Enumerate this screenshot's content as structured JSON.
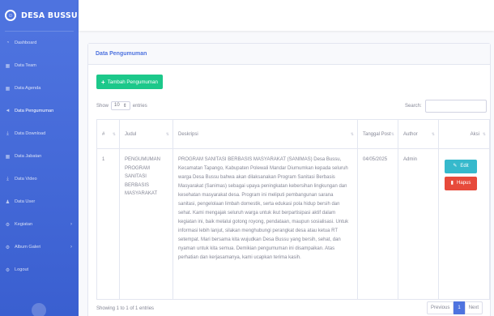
{
  "brand": {
    "name": "DESA BUSSU",
    "icon": "smile-icon"
  },
  "sidebar": {
    "items": [
      {
        "label": "Dashboard",
        "icon": "gauge-icon"
      },
      {
        "label": "Data Team",
        "icon": "table-icon"
      },
      {
        "label": "Data Agenda",
        "icon": "table-icon"
      },
      {
        "label": "Data Pengumuman",
        "icon": "bullhorn-icon"
      },
      {
        "label": "Data Download",
        "icon": "download-icon"
      },
      {
        "label": "Data Jabatan",
        "icon": "table-icon"
      },
      {
        "label": "Data Video",
        "icon": "download-icon"
      },
      {
        "label": "Data User",
        "icon": "users-icon"
      },
      {
        "label": "Kegiatan",
        "icon": "gear-icon",
        "arrow": "›"
      },
      {
        "label": "Album Galeri",
        "icon": "gear-icon",
        "arrow": "›"
      },
      {
        "label": "Logout",
        "icon": "gear-icon"
      }
    ]
  },
  "card": {
    "title": "Data Pengumuman"
  },
  "add_button": {
    "label": "Tambah Pengumuman",
    "icon": "plus-icon"
  },
  "length": {
    "show": "Show",
    "value": "10",
    "suffix": "entries"
  },
  "search": {
    "label": "Search:"
  },
  "table": {
    "headers": [
      "#",
      "Judul",
      "Deskripsi",
      "Tanggal Post",
      "Author",
      "Aksi"
    ],
    "rows": [
      {
        "no": "1",
        "judul": "PENGUMUMAN PROGRAM SANITASI BERBASIS MASYARAKAT",
        "deskripsi": "PROGRAM SANITASI BERBASIS MASYARAKAT (SANIMAS) Desa Bussu, Kecamatan Tapango, Kabupaten Polewali Mandar Diumumkan kepada seluruh warga Desa Bussu bahwa akan dilaksanakan Program Sanitasi Berbasis Masyarakat (Sanimas) sebagai upaya peningkatan kebersihan lingkungan dan kesehatan masyarakat desa. Program ini meliputi pembangunan sarana sanitasi, pengelolaan limbah domestik, serta edukasi pola hidup bersih dan sehat. Kami mengajak seluruh warga untuk ikut berpartisipasi aktif dalam kegiatan ini, baik melalui gotong royong, pendataan, maupun sosialisasi. Untuk informasi lebih lanjut, silakan menghubungi perangkat desa atau ketua RT setempat. Mari bersama kita wujudkan Desa Bussu yang bersih, sehat, dan nyaman untuk kita semua. Demikian pengumuman ini disampaikan. Atas perhatian dan kerjasamanya, kami ucapkan terima kasih.",
        "tanggal": "04/05/2025",
        "author": "Admin",
        "edit_label": "Edit",
        "hapus_label": "Hapus"
      }
    ]
  },
  "footer": {
    "info": "Showing 1 to 1 of 1 entries",
    "previous": "Previous",
    "page": "1",
    "next": "Next"
  },
  "colors": {
    "primary": "#4e73df",
    "success": "#1cc88a",
    "info": "#36b9cc",
    "danger": "#e74a3b"
  }
}
